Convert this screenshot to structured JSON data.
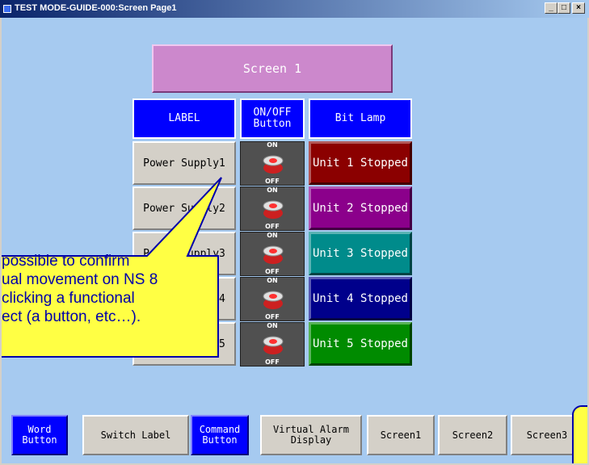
{
  "window": {
    "title": "TEST MODE-GUIDE-000:Screen Page1",
    "minimize": "_",
    "maximize": "□",
    "close": "×"
  },
  "screen_title": "Screen 1",
  "table": {
    "headers": {
      "label": "LABEL",
      "onoff": "ON/OFF\nButton",
      "lamp": "Bit Lamp"
    },
    "rows": [
      {
        "label": "Power Supply1",
        "on": "ON",
        "off": "OFF",
        "lamp": "Unit 1 Stopped",
        "lamp_color": "#8b0000"
      },
      {
        "label": "Power Supply2",
        "on": "ON",
        "off": "OFF",
        "lamp": "Unit 2 Stopped",
        "lamp_color": "#8b008b"
      },
      {
        "label": "Power Supply3",
        "on": "ON",
        "off": "OFF",
        "lamp": "Unit 3 Stopped",
        "lamp_color": "#008b8b"
      },
      {
        "label": "Power Supply4",
        "on": "ON",
        "off": "OFF",
        "lamp": "Unit 4 Stopped",
        "lamp_color": "#00008b"
      },
      {
        "label": "Power Supply5",
        "on": "ON",
        "off": "OFF",
        "lamp": "Unit 5 Stopped",
        "lamp_color": "#008b00"
      }
    ]
  },
  "callout": {
    "lines": [
      "possible to confirm",
      "ual movement on NS 8",
      "clicking a functional",
      "ect (a button, etc…)."
    ]
  },
  "bottom_buttons": [
    {
      "label": "Word\nButton",
      "style": "blue"
    },
    {
      "label": "Switch Label",
      "style": "gray"
    },
    {
      "label": "Command\nButton",
      "style": "blue"
    },
    {
      "label": "Virtual Alarm\nDisplay",
      "style": "gray"
    },
    {
      "label": "Screen1",
      "style": "gray"
    },
    {
      "label": "Screen2",
      "style": "gray"
    },
    {
      "label": "Screen3",
      "style": "gray"
    }
  ],
  "colors": {
    "background": "#a6caf0",
    "header_blue": "#0000ff",
    "callout_fill": "#ffff44"
  }
}
